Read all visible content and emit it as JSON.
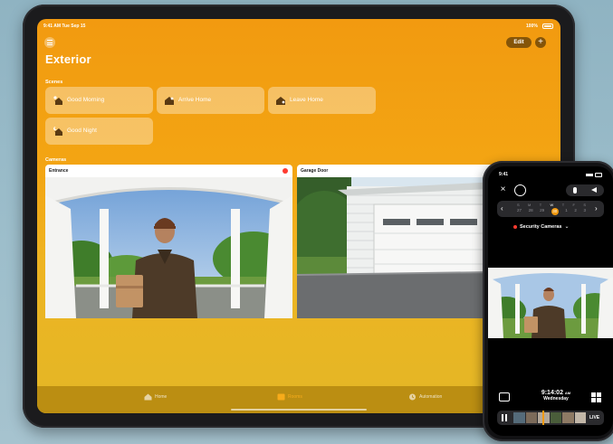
{
  "ipad": {
    "status_time": "9:41 AM   Tue Sep 15",
    "status_battery": "100%",
    "edit_label": "Edit",
    "add_label": "+",
    "title": "Exterior",
    "scenes_label": "Scenes",
    "scenes": [
      {
        "label": "Good Morning"
      },
      {
        "label": "Arrive Home"
      },
      {
        "label": "Leave Home"
      },
      {
        "label": "Good Night"
      }
    ],
    "cameras_label": "Cameras",
    "cameras": [
      {
        "label": "Entrance",
        "recording": true
      },
      {
        "label": "Garage Door",
        "recording": false
      }
    ],
    "tabs": [
      {
        "label": "Home",
        "icon": "house-icon",
        "active": false
      },
      {
        "label": "Rooms",
        "icon": "rooms-icon",
        "active": true
      },
      {
        "label": "Automation",
        "icon": "clock-icon",
        "active": false
      }
    ]
  },
  "iphone": {
    "status_time": "9:41",
    "timeline_days": [
      "S",
      "M",
      "T",
      "W",
      "T",
      "F",
      "S"
    ],
    "timeline_dates": [
      "27",
      "28",
      "29",
      "30",
      "1",
      "2",
      "3"
    ],
    "camera_name": "Security Cameras",
    "clip_time": "9:14:02",
    "clip_ampm": "AM",
    "clip_day": "Wednesday",
    "live_label": "LIVE"
  },
  "colors": {
    "accent_orange": "#f29a10",
    "record_red": "#ff3b30",
    "tab_active": "#f7ab1a"
  }
}
